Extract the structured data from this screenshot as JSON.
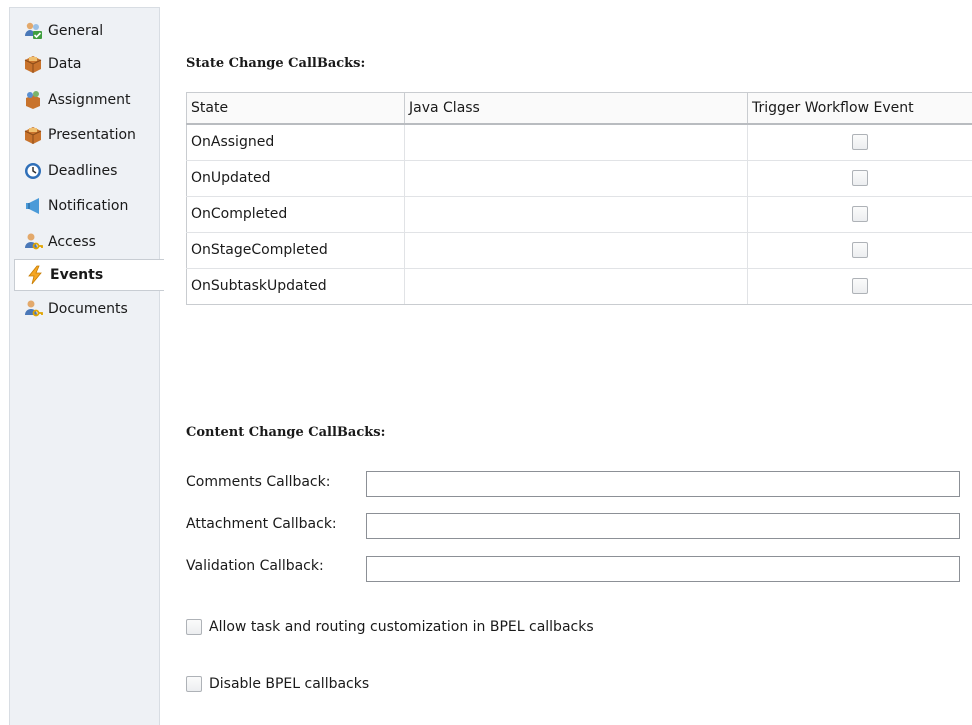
{
  "sidebar": {
    "items": [
      {
        "label": "General",
        "icon": "people-check-icon"
      },
      {
        "label": "Data",
        "icon": "package-icon"
      },
      {
        "label": "Assignment",
        "icon": "assignment-icon"
      },
      {
        "label": "Presentation",
        "icon": "package-icon"
      },
      {
        "label": "Deadlines",
        "icon": "clock-icon"
      },
      {
        "label": "Notification",
        "icon": "megaphone-icon"
      },
      {
        "label": "Access",
        "icon": "user-key-icon"
      },
      {
        "label": "Events",
        "icon": "lightning-icon"
      },
      {
        "label": "Documents",
        "icon": "user-key-icon"
      }
    ],
    "selected": "Events"
  },
  "state_section": {
    "title": "State Change CallBacks:",
    "columns": [
      "State",
      "Java Class",
      "Trigger Workflow Event"
    ],
    "rows": [
      {
        "state": "OnAssigned",
        "java_class": "",
        "trigger": false
      },
      {
        "state": "OnUpdated",
        "java_class": "",
        "trigger": false
      },
      {
        "state": "OnCompleted",
        "java_class": "",
        "trigger": false
      },
      {
        "state": "OnStageCompleted",
        "java_class": "",
        "trigger": false
      },
      {
        "state": "OnSubtaskUpdated",
        "java_class": "",
        "trigger": false
      }
    ]
  },
  "content_section": {
    "title": "Content Change CallBacks:",
    "comments_label": "Comments Callback:",
    "comments_value": "",
    "attachment_label": "Attachment Callback:",
    "attachment_value": "",
    "validation_label": "Validation Callback:",
    "validation_value": ""
  },
  "options": {
    "allow_customization_label": "Allow task and routing customization in BPEL callbacks",
    "allow_customization_checked": false,
    "disable_bpel_label": "Disable BPEL callbacks",
    "disable_bpel_checked": false
  },
  "colors": {
    "sidebar_bg": "#eef1f5",
    "border": "#c9ccd0",
    "accent_orange": "#f5a623"
  }
}
